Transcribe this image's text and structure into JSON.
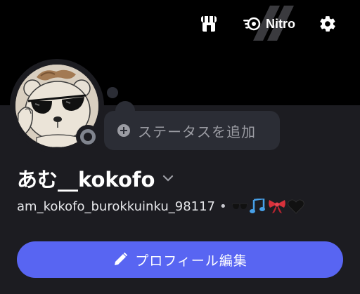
{
  "header": {
    "shop_icon": "shop-icon",
    "nitro_icon": "nitro-icon",
    "nitro_label": "Nitro",
    "settings_icon": "gear-icon"
  },
  "profile": {
    "avatar": "profile-avatar",
    "status_placeholder": "ステータスを追加",
    "display_name": "あむ__kokofo",
    "username": "am_kokofo_burokkuinku_98117",
    "separator": "•",
    "pronoun_emojis": [
      "sunglasses",
      "notes",
      "ribbon",
      "black-heart"
    ],
    "edit_button_label": "プロフィール編集"
  },
  "colors": {
    "accent": "#5865f2",
    "background": "#1c1c21",
    "surface": "#2b2d35",
    "banner": "#000000"
  }
}
